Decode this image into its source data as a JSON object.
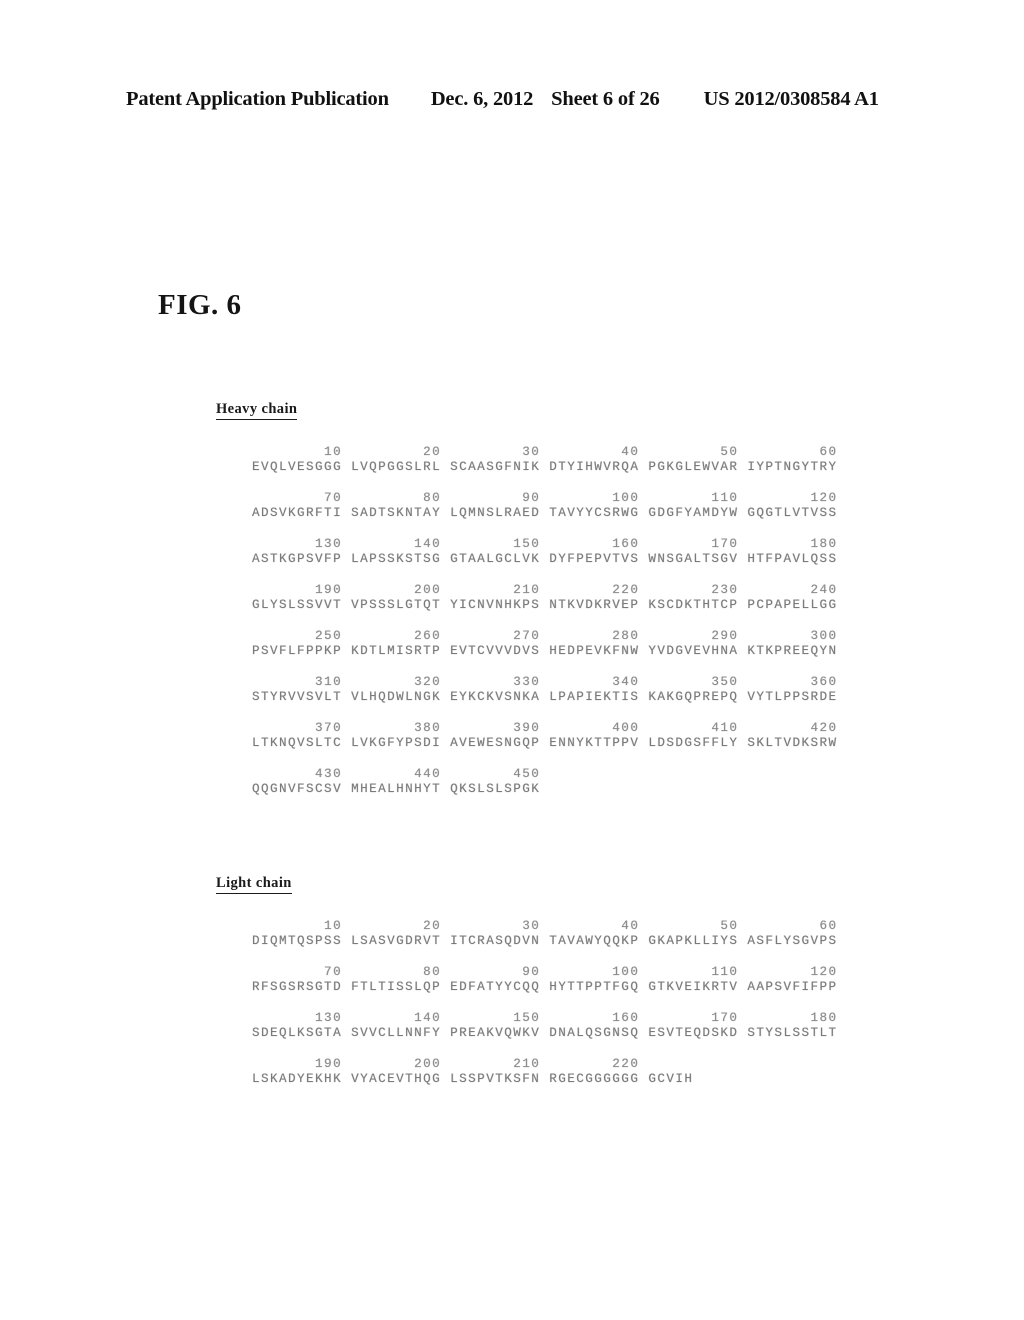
{
  "header": {
    "publication": "Patent Application Publication",
    "date": "Dec. 6, 2012",
    "sheet": "Sheet 6 of 26",
    "publication_number": "US 2012/0308584 A1"
  },
  "figure": {
    "label": "FIG. 6"
  },
  "heavy_chain": {
    "title": "Heavy chain",
    "rows": [
      {
        "numbers": "        10         20         30         40         50         60",
        "residues": "EVQLVESGGG LVQPGGSLRL SCAASGFNIK DTYIHWVRQA PGKGLEWVAR IYPTNGYTRY"
      },
      {
        "numbers": "        70         80         90        100        110        120",
        "residues": "ADSVKGRFTI SADTSKNTAY LQMNSLRAED TAVYYCSRWG GDGFYAMDYW GQGTLVTVSS"
      },
      {
        "numbers": "       130        140        150        160        170        180",
        "residues": "ASTKGPSVFP LAPSSKSTSG GTAALGCLVK DYFPEPVTVS WNSGALTSGV HTFPAVLQSS"
      },
      {
        "numbers": "       190        200        210        220        230        240",
        "residues": "GLYSLSSVVT VPSSSLGTQT YICNVNHKPS NTKVDKRVEP KSCDKTHTCP PCPAPELLGG"
      },
      {
        "numbers": "       250        260        270        280        290        300",
        "residues": "PSVFLFPPKP KDTLMISRTP EVTCVVVDVS HEDPEVKFNW YVDGVEVHNA KTKPREEQYN"
      },
      {
        "numbers": "       310        320        330        340        350        360",
        "residues": "STYRVVSVLT VLHQDWLNGK EYKCKVSNKA LPAPIEKTIS KAKGQPREPQ VYTLPPSRDE"
      },
      {
        "numbers": "       370        380        390        400        410        420",
        "residues": "LTKNQVSLTC LVKGFYPSDI AVEWESNGQP ENNYKTTPPV LDSDGSFFLY SKLTVDKSRW"
      },
      {
        "numbers": "       430        440        450",
        "residues": "QQGNVFSCSV MHEALHNHYT QKSLSLSPGK"
      }
    ]
  },
  "light_chain": {
    "title": "Light chain",
    "rows": [
      {
        "numbers": "        10         20         30         40         50         60",
        "residues": "DIQMTQSPSS LSASVGDRVT ITCRASQDVN TAVAWYQQKP GKAPKLLIYS ASFLYSGVPS"
      },
      {
        "numbers": "        70         80         90        100        110        120",
        "residues": "RFSGSRSGTD FTLTISSLQP EDFATYYCQQ HYTTPPTFGQ GTKVEIKRTV AAPSVFIFPP"
      },
      {
        "numbers": "       130        140        150        160        170        180",
        "residues": "SDEQLKSGTA SVVCLLNNFY PREAKVQWKV DNALQSGNSQ ESVTEQDSKD STYSLSSTLT"
      },
      {
        "numbers": "       190        200        210        220",
        "residues": "LSKADYEKHK VYACEVTHQG LSSPVTKSFN RGECGGGGGG GCVIH"
      }
    ]
  }
}
